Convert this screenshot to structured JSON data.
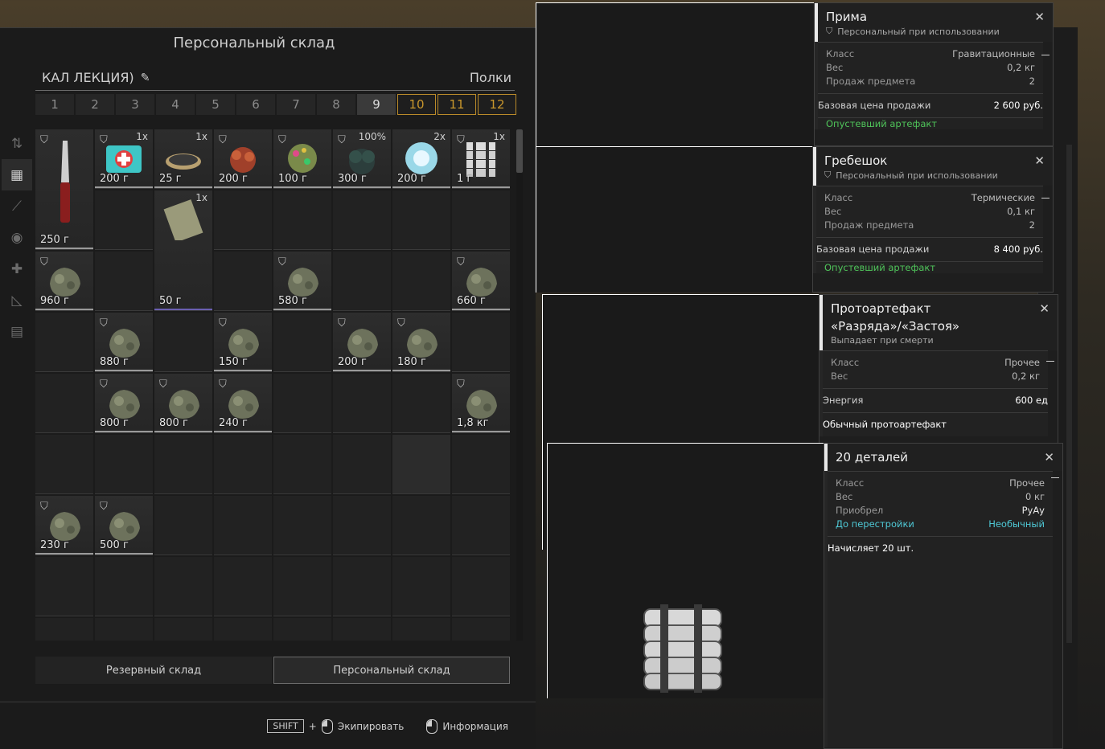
{
  "stash": {
    "title": "Персональный склад",
    "name": "КАЛ ЛЕКЦИЯ)",
    "shelves_label": "Полки",
    "tabs": [
      "1",
      "2",
      "3",
      "4",
      "5",
      "6",
      "7",
      "8",
      "9",
      "10",
      "11",
      "12"
    ],
    "active_tab": "9",
    "bottom_tabs": [
      "Резервный склад",
      "Персональный склад"
    ],
    "hints": {
      "shift": "SHIFT",
      "plus": "+",
      "equip": "Экипировать",
      "info": "Информация"
    },
    "items": [
      {
        "weight": "250 г",
        "qty": "",
        "art": "knife"
      },
      {
        "weight": "200 г",
        "qty": "1x",
        "art": "medkit"
      },
      {
        "weight": "25 г",
        "qty": "1x",
        "art": "tin"
      },
      {
        "weight": "200 г",
        "qty": "",
        "art": "crab"
      },
      {
        "weight": "100 г",
        "qty": "",
        "art": "colorful"
      },
      {
        "weight": "300 г",
        "qty": "100%",
        "art": "bush"
      },
      {
        "weight": "200 г",
        "qty": "2x",
        "art": "orb"
      },
      {
        "weight": "1 г",
        "qty": "1x",
        "art": "bricks"
      },
      {
        "weight": "50 г",
        "qty": "1x",
        "art": "map"
      },
      {
        "weight": "960 г",
        "art": "rock"
      },
      {
        "weight": "580 г",
        "art": "rock"
      },
      {
        "weight": "660 г",
        "art": "rock"
      },
      {
        "weight": "880 г",
        "art": "rock"
      },
      {
        "weight": "150 г",
        "art": "rock"
      },
      {
        "weight": "200 г",
        "art": "rock"
      },
      {
        "weight": "180 г",
        "art": "rock"
      },
      {
        "weight": "800 г",
        "art": "rock"
      },
      {
        "weight": "800 г",
        "art": "rock"
      },
      {
        "weight": "240 г",
        "art": "rock"
      },
      {
        "weight": "1,8 кг",
        "art": "rock"
      },
      {
        "weight": "230 г",
        "art": "rock"
      },
      {
        "weight": "500 г",
        "art": "rock"
      }
    ]
  },
  "tooltips": [
    {
      "title": "Прима",
      "subtitle": "Персональный при использовании",
      "rows": [
        [
          "Класс",
          "Гравитационные"
        ],
        [
          "Вес",
          "0,2 кг"
        ],
        [
          "Продаж предмета",
          "2"
        ]
      ],
      "price": [
        "Базовая цена продажи",
        "2 600 руб."
      ],
      "status": "Опустевший артефакт"
    },
    {
      "title": "Гребешок",
      "subtitle": "Персональный при использовании",
      "rows": [
        [
          "Класс",
          "Термические"
        ],
        [
          "Вес",
          "0,1 кг"
        ],
        [
          "Продаж предмета",
          "2"
        ]
      ],
      "price": [
        "Базовая цена продажи",
        "8 400 руб."
      ],
      "status": "Опустевший артефакт"
    },
    {
      "title_line1": "Протоартефакт",
      "title_line2": "«Разряда»/«Застоя»",
      "subtitle": "Выпадает при смерти",
      "rows": [
        [
          "Класс",
          "Прочее"
        ],
        [
          "Вес",
          "0,2 кг"
        ]
      ],
      "energy": [
        "Энергия",
        "600 ед"
      ],
      "note": "Обычный протоартефакт"
    },
    {
      "title": "20 деталей",
      "rows": [
        [
          "Класс",
          "Прочее"
        ],
        [
          "Вес",
          "0 кг"
        ],
        [
          "Приобрел",
          "РуАу"
        ]
      ],
      "rarity": [
        "До перестройки",
        "Необычный"
      ],
      "note": "Начисляет 20 шт."
    }
  ]
}
